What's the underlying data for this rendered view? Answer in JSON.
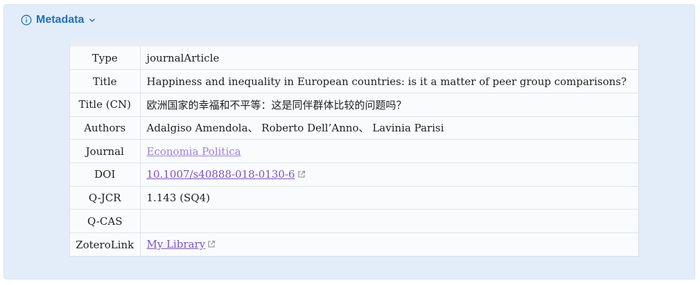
{
  "header": {
    "title": "Metadata"
  },
  "metadata": {
    "type": {
      "label": "Type",
      "value": "journalArticle"
    },
    "title": {
      "label": "Title",
      "value": "Happiness and inequality in European countries: is it a matter of peer group comparisons?"
    },
    "title_cn": {
      "label": "Title (CN)",
      "value": "欧洲国家的幸福和不平等：这是同伴群体比较的问题吗？"
    },
    "authors": {
      "label": "Authors",
      "value": "Adalgiso Amendola、 Roberto Dell’Anno、 Lavinia Parisi"
    },
    "journal": {
      "label": "Journal",
      "value": "Economia Politica"
    },
    "doi": {
      "label": "DOI",
      "value": "10.1007/s40888-018-0130-6"
    },
    "qjcr": {
      "label": "Q-JCR",
      "value": "1.143 (SQ4)"
    },
    "qcas": {
      "label": "Q-CAS",
      "value": ""
    },
    "zotero": {
      "label": "ZoteroLink",
      "value": "My Library"
    }
  },
  "colors": {
    "accent": "#1a6fc7",
    "link": "#7a52c7",
    "panel_bg": "#e3edf9"
  },
  "icons": {
    "info": "info-circle-icon",
    "chevron": "chevron-down-icon",
    "external": "external-link-icon"
  }
}
